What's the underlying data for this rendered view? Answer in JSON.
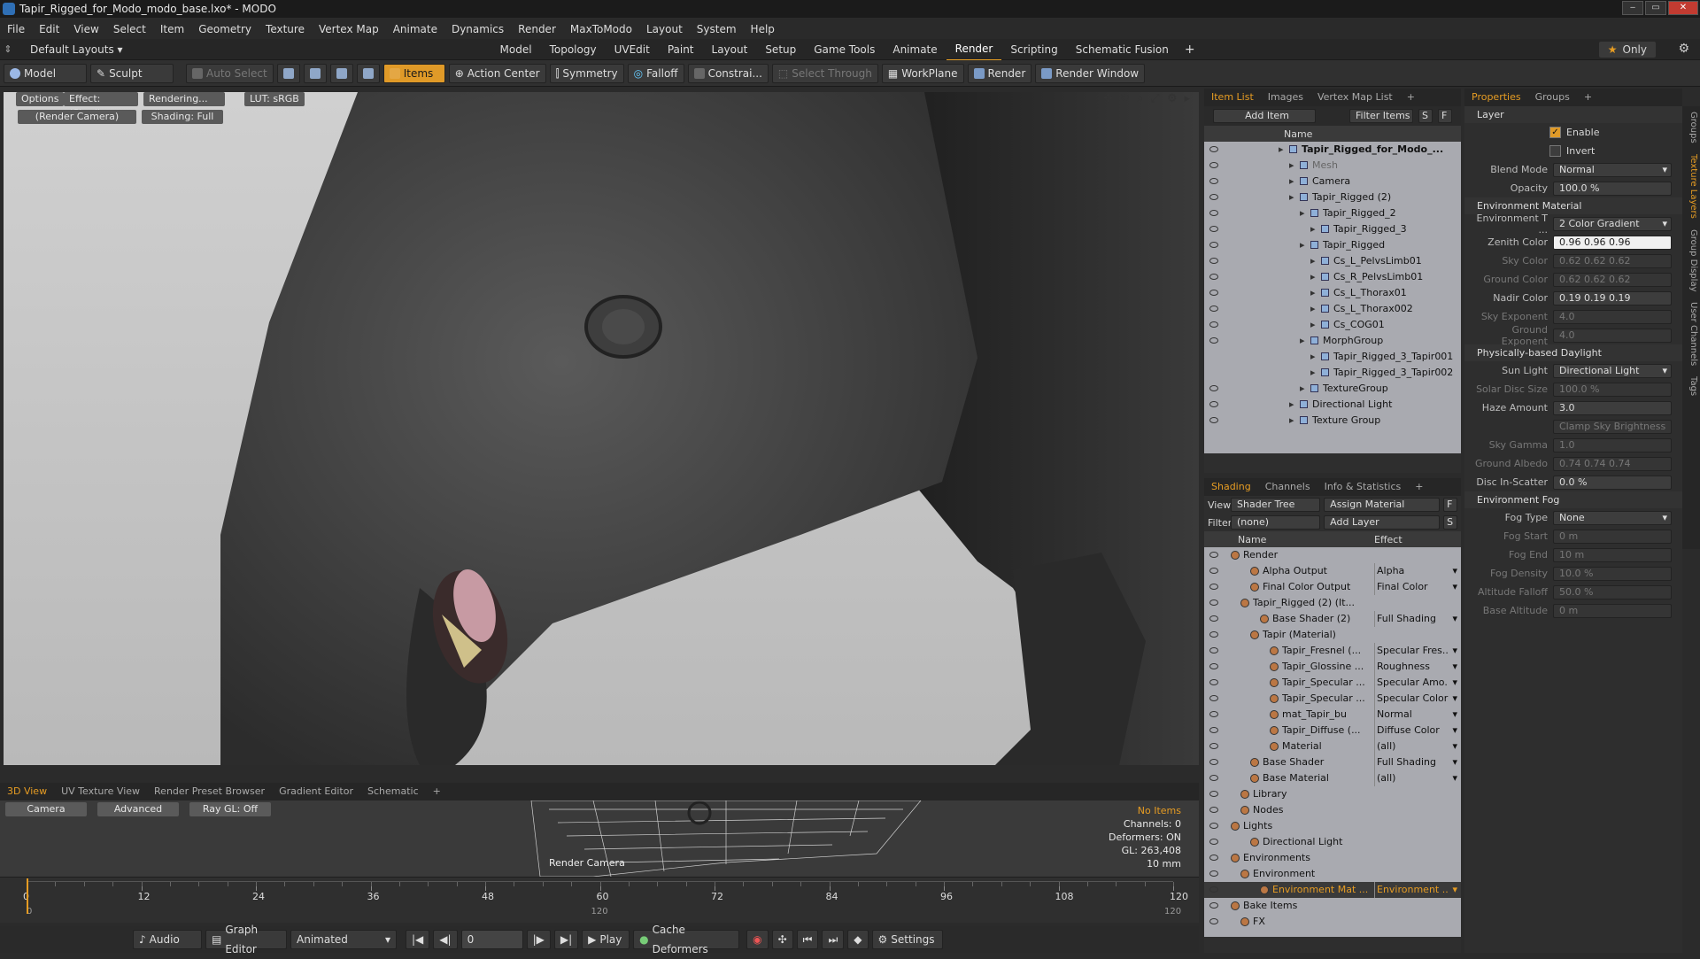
{
  "title": "Tapir_Rigged_for_Modo_modo_base.lxo* - MODO",
  "menu": [
    "File",
    "Edit",
    "View",
    "Select",
    "Item",
    "Geometry",
    "Texture",
    "Vertex Map",
    "Animate",
    "Dynamics",
    "Render",
    "MaxToModo",
    "Layout",
    "System",
    "Help"
  ],
  "layout_dropdown": "Default Layouts ▾",
  "layout_tabs": [
    "Model",
    "Topology",
    "UVEdit",
    "Paint",
    "Layout",
    "Setup",
    "Game Tools",
    "Animate",
    "Render",
    "Scripting",
    "Schematic Fusion"
  ],
  "active_layout": "Render",
  "only_label": "Only",
  "toolbar": {
    "model": "Model",
    "sculpt": "Sculpt",
    "auto_select": "Auto Select",
    "items": "Items",
    "action_center": "Action Center",
    "symmetry": "Symmetry",
    "falloff": "Falloff",
    "constrain": "Constrai...",
    "select_through": "Select Through",
    "workplane": "WorkPlane",
    "render": "Render",
    "render_window": "Render Window"
  },
  "viewport": {
    "options": "Options",
    "effect": "Effect: (Shadi...",
    "rendering": "Rendering...",
    "lut": "LUT: sRGB",
    "camera": "(Render Camera)",
    "shading": "Shading: Full"
  },
  "bottom_tabs": [
    "3D View",
    "UV Texture View",
    "Render Preset Browser",
    "Gradient Editor",
    "Schematic"
  ],
  "mini": {
    "camera": "Camera",
    "advanced": "Advanced",
    "raygl": "Ray GL: Off",
    "info": [
      "No Items",
      "Channels: 0",
      "Deformers: ON",
      "GL: 263,408",
      "10 mm"
    ],
    "render_cam": "Render Camera"
  },
  "timeline": {
    "ticks": [
      "0",
      "12",
      "24",
      "36",
      "48",
      "60",
      "72",
      "84",
      "96",
      "108",
      "120"
    ],
    "sub": [
      "0",
      "120",
      "120"
    ]
  },
  "bottombar": {
    "audio": "Audio",
    "graph": "Graph Editor",
    "animated": "Animated",
    "frame": "0",
    "play": "Play",
    "cache": "Cache Deformers",
    "settings": "Settings"
  },
  "itemlist": {
    "tabs": [
      "Item List",
      "Images",
      "Vertex Map List"
    ],
    "add_item": "Add Item",
    "filter": "Filter Items",
    "s": "S",
    "f": "F",
    "col": "Name",
    "rows": [
      {
        "t": "Tapir_Rigged_for_Modo_...",
        "d": 0,
        "eye": true,
        "b": true
      },
      {
        "t": "Mesh",
        "d": 1,
        "eye": true,
        "dim": true
      },
      {
        "t": "Camera",
        "d": 1,
        "eye": true
      },
      {
        "t": "Tapir_Rigged (2)",
        "d": 1,
        "eye": true
      },
      {
        "t": "Tapir_Rigged_2",
        "d": 2,
        "eye": true
      },
      {
        "t": "Tapir_Rigged_3",
        "d": 3,
        "eye": true
      },
      {
        "t": "Tapir_Rigged",
        "d": 2,
        "eye": true
      },
      {
        "t": "Cs_L_PelvsLimb01",
        "d": 3,
        "eye": true
      },
      {
        "t": "Cs_R_PelvsLimb01",
        "d": 3,
        "eye": true
      },
      {
        "t": "Cs_L_Thorax01",
        "d": 3,
        "eye": true
      },
      {
        "t": "Cs_L_Thorax002",
        "d": 3,
        "eye": true
      },
      {
        "t": "Cs_COG01",
        "d": 3,
        "eye": true
      },
      {
        "t": "MorphGroup",
        "d": 2,
        "eye": true
      },
      {
        "t": "Tapir_Rigged_3_Tapir001",
        "d": 3,
        "eye": false
      },
      {
        "t": "Tapir_Rigged_3_Tapir002",
        "d": 3,
        "eye": false
      },
      {
        "t": "TextureGroup",
        "d": 2,
        "eye": true
      },
      {
        "t": "Directional Light",
        "d": 1,
        "eye": true
      },
      {
        "t": "Texture Group",
        "d": 1,
        "eye": true
      }
    ]
  },
  "shading": {
    "tabs": [
      "Shading",
      "Channels",
      "Info & Statistics"
    ],
    "view_lbl": "View",
    "view": "Shader Tree",
    "assign": "Assign Material",
    "f": "F",
    "filter_lbl": "Filter",
    "filter": "(none)",
    "add_layer": "Add Layer",
    "s": "S",
    "col_name": "Name",
    "col_effect": "Effect",
    "rows": [
      {
        "t": "Render",
        "e": "",
        "d": 0
      },
      {
        "t": "Alpha Output",
        "e": "Alpha",
        "d": 2
      },
      {
        "t": "Final Color Output",
        "e": "Final Color",
        "d": 2
      },
      {
        "t": "Tapir_Rigged (2) (It...",
        "e": "",
        "d": 1
      },
      {
        "t": "Base Shader (2)",
        "e": "Full Shading",
        "d": 3
      },
      {
        "t": "Tapir (Material)",
        "e": "",
        "d": 2
      },
      {
        "t": "Tapir_Fresnel (...",
        "e": "Specular Fres...",
        "d": 4
      },
      {
        "t": "Tapir_Glossine ...",
        "e": "Roughness",
        "d": 4
      },
      {
        "t": "Tapir_Specular ...",
        "e": "Specular Amo...",
        "d": 4
      },
      {
        "t": "Tapir_Specular ...",
        "e": "Specular Color",
        "d": 4
      },
      {
        "t": "mat_Tapir_bu",
        "e": "Normal",
        "d": 4
      },
      {
        "t": "Tapir_Diffuse (...",
        "e": "Diffuse Color",
        "d": 4
      },
      {
        "t": "Material",
        "e": "(all)",
        "d": 4
      },
      {
        "t": "Base Shader",
        "e": "Full Shading",
        "d": 2
      },
      {
        "t": "Base Material",
        "e": "(all)",
        "d": 2
      },
      {
        "t": "Library",
        "e": "",
        "d": 1
      },
      {
        "t": "Nodes",
        "e": "",
        "d": 1
      },
      {
        "t": "Lights",
        "e": "",
        "d": 0
      },
      {
        "t": "Directional Light",
        "e": "",
        "d": 2
      },
      {
        "t": "Environments",
        "e": "",
        "d": 0
      },
      {
        "t": "Environment",
        "e": "",
        "d": 1
      },
      {
        "t": "Environment Mat ...",
        "e": "Environment ...",
        "d": 3,
        "sel": true
      },
      {
        "t": "Bake Items",
        "e": "",
        "d": 0
      },
      {
        "t": "FX",
        "e": "",
        "d": 1
      }
    ]
  },
  "properties": {
    "tabs": [
      "Properties",
      "Groups"
    ],
    "layer": "Layer",
    "enable": "Enable",
    "invert": "Invert",
    "rows": [
      {
        "l": "Blend Mode",
        "v": "Normal",
        "dd": true
      },
      {
        "l": "Opacity",
        "v": "100.0 %"
      }
    ],
    "env_mat": "Environment Material",
    "env_rows": [
      {
        "l": "Environment T ...",
        "v": "2 Color Gradient",
        "dd": true
      },
      {
        "l": "Zenith Color",
        "v": "0.96   0.96   0.96",
        "bright": true
      },
      {
        "l": "Sky Color",
        "v": "0.62   0.62   0.62",
        "dim": true
      },
      {
        "l": "Ground Color",
        "v": "0.62   0.62   0.62",
        "dim": true
      },
      {
        "l": "Nadir Color",
        "v": "0.19   0.19   0.19"
      },
      {
        "l": "Sky Exponent",
        "v": "4.0",
        "dim": true
      },
      {
        "l": "Ground Exponent",
        "v": "4.0",
        "dim": true
      }
    ],
    "daylight": "Physically-based Daylight",
    "day_rows": [
      {
        "l": "Sun Light",
        "v": "Directional Light",
        "dd": true
      },
      {
        "l": "Solar Disc Size",
        "v": "100.0 %",
        "dim": true
      },
      {
        "l": "Haze Amount",
        "v": "3.0"
      },
      {
        "l": "",
        "v": "Clamp Sky Brightness",
        "dim": true
      },
      {
        "l": "Sky Gamma",
        "v": "1.0",
        "dim": true
      },
      {
        "l": "Ground Albedo",
        "v": "0.74   0.74   0.74",
        "dim": true
      },
      {
        "l": "Disc In-Scatter",
        "v": "0.0 %"
      }
    ],
    "fog": "Environment Fog",
    "fog_rows": [
      {
        "l": "Fog Type",
        "v": "None",
        "dd": true
      },
      {
        "l": "Fog Start",
        "v": "0 m",
        "dim": true
      },
      {
        "l": "Fog End",
        "v": "10 m",
        "dim": true
      },
      {
        "l": "Fog Density",
        "v": "10.0 %",
        "dim": true
      },
      {
        "l": "Altitude Falloff",
        "v": "50.0 %",
        "dim": true
      },
      {
        "l": "Base Altitude",
        "v": "0 m",
        "dim": true
      }
    ],
    "side_tabs": [
      "Groups",
      "Texture Layers",
      "Group Display",
      "User Channels",
      "Tags"
    ]
  }
}
